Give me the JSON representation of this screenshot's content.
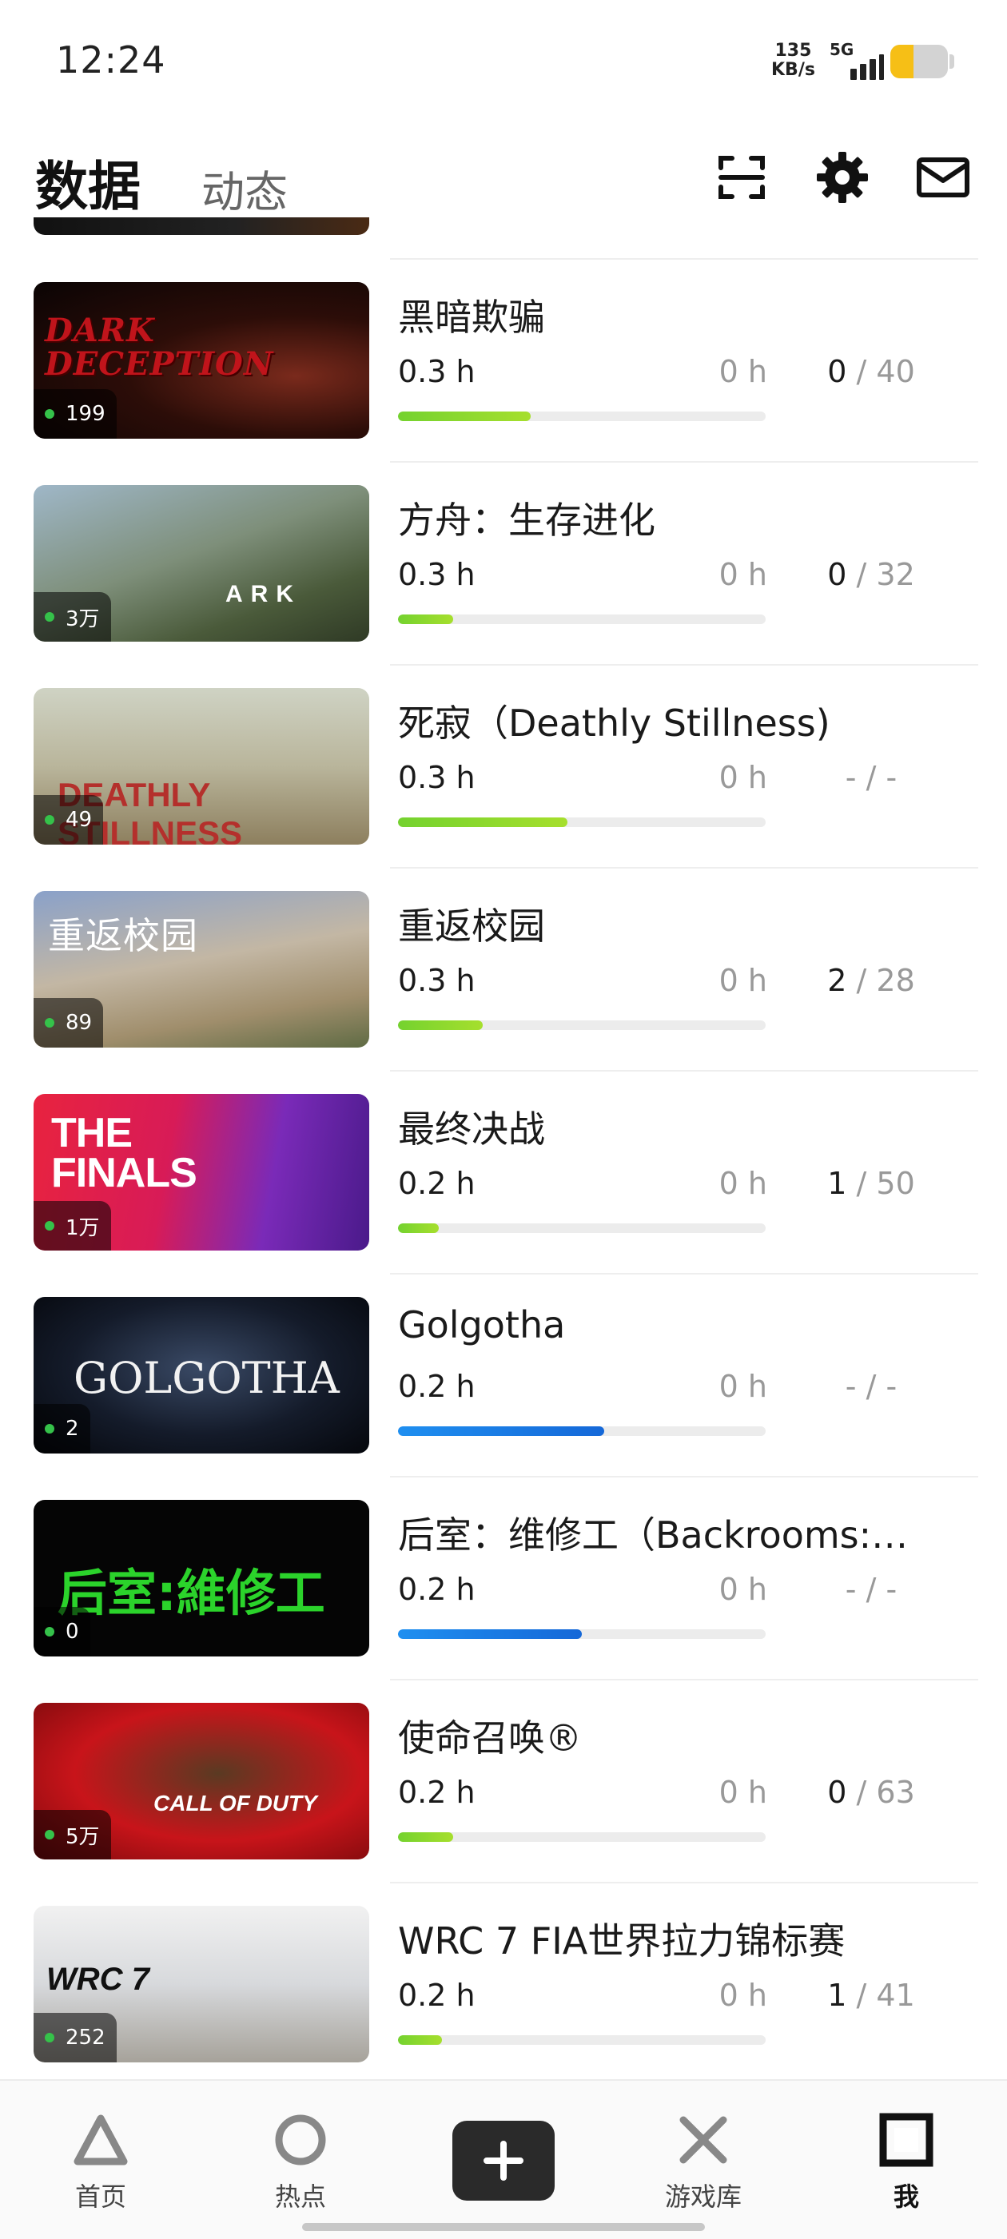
{
  "status": {
    "time": "12:24",
    "speed_value": "135",
    "speed_unit": "KB/s",
    "network": "5G",
    "battery_level": 0.4
  },
  "header": {
    "tab_active": "数据",
    "tab_inactive": "动态",
    "icons": [
      "scan-icon",
      "gear-icon",
      "mail-icon"
    ]
  },
  "games": [
    {
      "title": "黑暗欺骗",
      "cover_text": "DARK DECEPTION",
      "online": "199",
      "hours": "0.3 h",
      "recent": "0 h",
      "ach_current": "0",
      "ach_sep": " / ",
      "ach_total": "40",
      "progress": 0.36,
      "bar_color": "green"
    },
    {
      "title": "方舟：生存进化",
      "cover_text": "ARK",
      "online": "3万",
      "hours": "0.3 h",
      "recent": "0 h",
      "ach_current": "0",
      "ach_sep": " / ",
      "ach_total": "32",
      "progress": 0.15,
      "bar_color": "green"
    },
    {
      "title": "死寂（Deathly Stillness)",
      "cover_text": "DEATHLY STILLNESS",
      "online": "49",
      "hours": "0.3 h",
      "recent": "0 h",
      "ach_current": "",
      "ach_sep": "- / -",
      "ach_total": "",
      "progress": 0.46,
      "bar_color": "green"
    },
    {
      "title": "重返校园",
      "cover_text": "重返校园",
      "online": "89",
      "hours": "0.3 h",
      "recent": "0 h",
      "ach_current": "2",
      "ach_sep": " / ",
      "ach_total": "28",
      "progress": 0.23,
      "bar_color": "green"
    },
    {
      "title": "最终决战",
      "cover_text": "THE FINALS",
      "online": "1万",
      "hours": "0.2 h",
      "recent": "0 h",
      "ach_current": "1",
      "ach_sep": " / ",
      "ach_total": "50",
      "progress": 0.11,
      "bar_color": "green"
    },
    {
      "title": "Golgotha",
      "cover_text": "GOLGOTHA",
      "online": "2",
      "hours": "0.2 h",
      "recent": "0 h",
      "ach_current": "",
      "ach_sep": "- / -",
      "ach_total": "",
      "progress": 0.56,
      "bar_color": "blue"
    },
    {
      "title": "后室：维修工（Backrooms:…",
      "cover_text": "后室:維修工",
      "online": "0",
      "hours": "0.2 h",
      "recent": "0 h",
      "ach_current": "",
      "ach_sep": "- / -",
      "ach_total": "",
      "progress": 0.5,
      "bar_color": "blue"
    },
    {
      "title": "使命召唤®",
      "cover_text": "CALL OF DUTY",
      "online": "5万",
      "hours": "0.2 h",
      "recent": "0 h",
      "ach_current": "0",
      "ach_sep": " / ",
      "ach_total": "63",
      "progress": 0.15,
      "bar_color": "green"
    },
    {
      "title": "WRC 7 FIA世界拉力锦标赛",
      "cover_text": "WRC 7",
      "online": "252",
      "hours": "0.2 h",
      "recent": "0 h",
      "ach_current": "1",
      "ach_sep": " / ",
      "ach_total": "41",
      "progress": 0.12,
      "bar_color": "green"
    }
  ],
  "nav": [
    {
      "label": "首页",
      "icon": "triangle-icon"
    },
    {
      "label": "热点",
      "icon": "circle-icon"
    },
    {
      "label": "",
      "icon": "plus-icon"
    },
    {
      "label": "游戏库",
      "icon": "cross-icon"
    },
    {
      "label": "我",
      "icon": "square-icon"
    }
  ]
}
